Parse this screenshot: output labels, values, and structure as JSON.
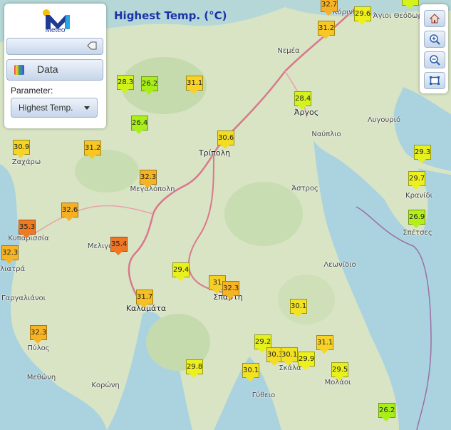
{
  "title": "Highest Temp. (°C)",
  "logo": {
    "text": "Meteo"
  },
  "panel": {
    "data_label": "Data",
    "parameter_label": "Parameter:",
    "parameter_value": "Highest Temp."
  },
  "colors": {
    "sea": "#aad3df",
    "land": "#d8e4c4",
    "road": "#d9788c",
    "title": "#1a33a8"
  },
  "places": [
    {
      "name": "Νεμέα",
      "big": false
    },
    {
      "name": "Άργος",
      "big": true
    },
    {
      "name": "Ναύπλιο",
      "big": false
    },
    {
      "name": "Λυγουριό",
      "big": false
    },
    {
      "name": "Τρίπολη",
      "big": true
    },
    {
      "name": "Ζαχάρω",
      "big": false
    },
    {
      "name": "Μεγαλόπολη",
      "big": false
    },
    {
      "name": "Άστρος",
      "big": false
    },
    {
      "name": "Κρανίδι",
      "big": false
    },
    {
      "name": "Σπέτσες",
      "big": false
    },
    {
      "name": "Κυπαρισσία",
      "big": false
    },
    {
      "name": "Μελιγαλάς",
      "big": false
    },
    {
      "name": "Φιλιατρά",
      "big": false
    },
    {
      "name": "Λεωνίδιο",
      "big": false
    },
    {
      "name": "Γαργαλιάνοι",
      "big": false
    },
    {
      "name": "Καλαμάτα",
      "big": true
    },
    {
      "name": "Σπάρτη",
      "big": true
    },
    {
      "name": "Πύλος",
      "big": false
    },
    {
      "name": "Σκάλα",
      "big": false
    },
    {
      "name": "Μεθώνη",
      "big": false
    },
    {
      "name": "Κορώνη",
      "big": false
    },
    {
      "name": "Μολάοι",
      "big": false
    },
    {
      "name": "Γύθειο",
      "big": false
    },
    {
      "name": "Κόρινθος",
      "big": false
    },
    {
      "name": "Άγιοι Θεόδωροι",
      "big": false
    }
  ],
  "stations": [
    {
      "value": "32.7",
      "color": "#f6b224"
    },
    {
      "value": "29.6",
      "color": "#eef01c"
    },
    {
      "value": "28.4",
      "color": "#d4f21e"
    },
    {
      "value": "31.2",
      "color": "#f7c824"
    },
    {
      "value": "28.3",
      "color": "#cff21c"
    },
    {
      "value": "26.2",
      "color": "#a8ef1a"
    },
    {
      "value": "31.1",
      "color": "#f8d226"
    },
    {
      "value": "28.4",
      "color": "#d4f21e"
    },
    {
      "value": "26.4",
      "color": "#abef1a"
    },
    {
      "value": "30.6",
      "color": "#f3dc24"
    },
    {
      "value": "30.9",
      "color": "#f5d424"
    },
    {
      "value": "31.2",
      "color": "#f7c824"
    },
    {
      "value": "29.3",
      "color": "#e6f01e"
    },
    {
      "value": "32.3",
      "color": "#f6b424"
    },
    {
      "value": "29.7",
      "color": "#ecf01e"
    },
    {
      "value": "32.6",
      "color": "#f6b024"
    },
    {
      "value": "26.9",
      "color": "#b4ef1a"
    },
    {
      "value": "35.3",
      "color": "#ef7a22"
    },
    {
      "value": "35.4",
      "color": "#ef7622"
    },
    {
      "value": "32.3",
      "color": "#f6b424"
    },
    {
      "value": "29.4",
      "color": "#e8f01e"
    },
    {
      "value": "31",
      "color": "#f6cf24"
    },
    {
      "value": "32.3",
      "color": "#f6b424"
    },
    {
      "value": "31.7",
      "color": "#f6c024"
    },
    {
      "value": "30.1",
      "color": "#f2e224"
    },
    {
      "value": "32.3",
      "color": "#f6b424"
    },
    {
      "value": "29.2",
      "color": "#e6f01e"
    },
    {
      "value": "31.1",
      "color": "#f8d226"
    },
    {
      "value": "30.3",
      "color": "#f2dc24"
    },
    {
      "value": "30.1",
      "color": "#f2e224"
    },
    {
      "value": "29.9",
      "color": "#eef01e"
    },
    {
      "value": "29.8",
      "color": "#ecf01e"
    },
    {
      "value": "30.1",
      "color": "#f2e224"
    },
    {
      "value": "29.5",
      "color": "#e9f01e"
    },
    {
      "value": "26.2",
      "color": "#a8ef1a"
    }
  ]
}
